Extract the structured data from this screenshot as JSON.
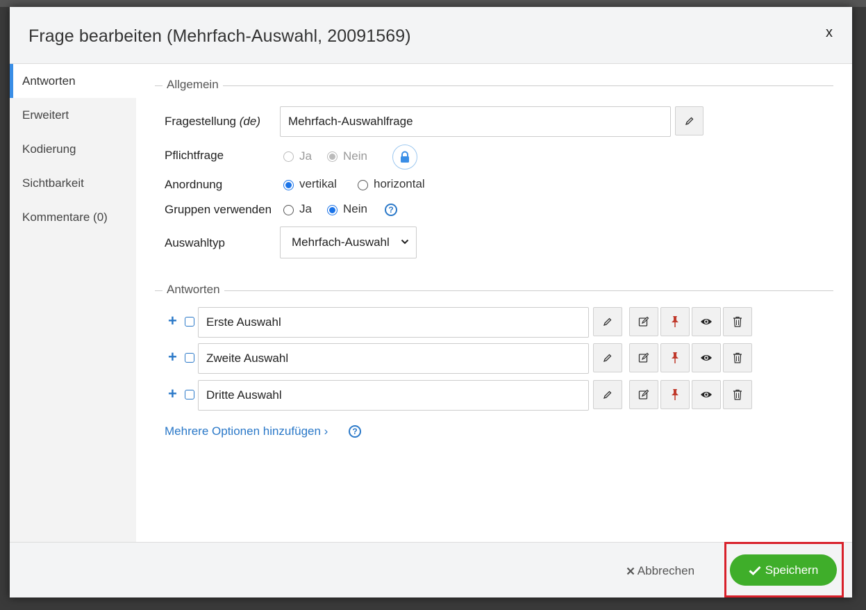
{
  "modal": {
    "title": "Frage bearbeiten (Mehrfach-Auswahl, 20091569)",
    "close_label": "x"
  },
  "sidebar": {
    "items": [
      {
        "label": "Antworten",
        "active": true
      },
      {
        "label": "Erweitert",
        "active": false
      },
      {
        "label": "Kodierung",
        "active": false
      },
      {
        "label": "Sichtbarkeit",
        "active": false
      },
      {
        "label": "Kommentare (0)",
        "active": false
      }
    ]
  },
  "general": {
    "legend": "Allgemein",
    "question": {
      "label": "Fragestellung",
      "lang": "(de)",
      "value": "Mehrfach-Auswahlfrage"
    },
    "required": {
      "label": "Pflichtfrage",
      "yes": "Ja",
      "no": "Nein",
      "selected": "no",
      "disabled": true
    },
    "arrangement": {
      "label": "Anordnung",
      "vertical": "vertikal",
      "horizontal": "horizontal",
      "selected": "vertical"
    },
    "groups": {
      "label": "Gruppen verwenden",
      "yes": "Ja",
      "no": "Nein",
      "selected": "no"
    },
    "selection_type": {
      "label": "Auswahltyp",
      "value": "Mehrfach-Auswahl"
    }
  },
  "answers": {
    "legend": "Antworten",
    "items": [
      {
        "value": "Erste Auswahl"
      },
      {
        "value": "Zweite Auswahl"
      },
      {
        "value": "Dritte Auswahl"
      }
    ],
    "add_more": "Mehrere Optionen hinzufügen ›"
  },
  "footer": {
    "cancel": "Abbrechen",
    "save": "Speichern"
  },
  "colors": {
    "accent": "#2a78c8",
    "save_green": "#3fae2a",
    "highlight_red": "#d8202a",
    "pin_red": "#c0392b"
  }
}
